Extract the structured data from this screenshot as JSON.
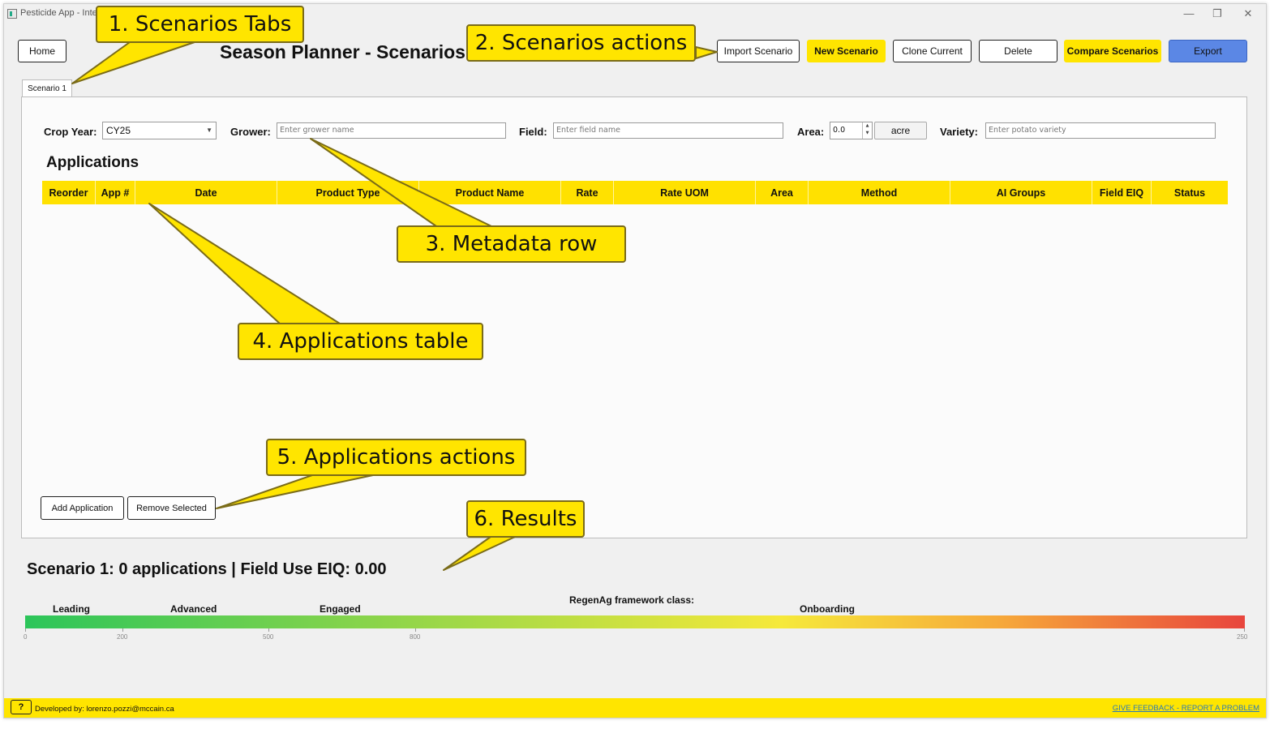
{
  "window": {
    "title": "Pesticide App - Intern"
  },
  "header": {
    "home_label": "Home",
    "title": "Season Planner - Scenarios",
    "actions": {
      "import": "Import Scenario",
      "new": "New Scenario",
      "clone": "Clone Current",
      "delete": "Delete",
      "compare": "Compare Scenarios",
      "export": "Export"
    }
  },
  "tabs": [
    {
      "label": "Scenario 1"
    }
  ],
  "metadata": {
    "crop_year_label": "Crop Year:",
    "crop_year_value": "CY25",
    "grower_label": "Grower:",
    "grower_placeholder": "Enter grower name",
    "field_label": "Field:",
    "field_placeholder": "Enter field name",
    "area_label": "Area:",
    "area_value": "0.0",
    "area_unit": "acre",
    "variety_label": "Variety:",
    "variety_placeholder": "Enter potato variety"
  },
  "applications": {
    "title": "Applications",
    "columns": [
      "Reorder",
      "App #",
      "Date",
      "Product Type",
      "Product Name",
      "Rate",
      "Rate UOM",
      "Area",
      "Method",
      "AI Groups",
      "Field EIQ",
      "Status"
    ],
    "rows": [],
    "add_label": "Add Application",
    "remove_label": "Remove Selected"
  },
  "results": {
    "summary": "Scenario 1: 0 applications | Field Use EIQ: 0.00",
    "framework_label": "RegenAg framework class:",
    "classes": [
      "Leading",
      "Advanced",
      "Engaged",
      "Onboarding"
    ],
    "ticks": [
      "0",
      "200",
      "500",
      "800",
      "250"
    ]
  },
  "footer": {
    "help_label": "?",
    "developer": "Developed by: lorenzo.pozzi@mccain.ca",
    "feedback": "GIVE FEEDBACK - REPORT A PROBLEM"
  },
  "callouts": [
    "1. Scenarios Tabs",
    "2. Scenarios actions",
    "3. Metadata row",
    "4. Applications table",
    "5. Applications actions",
    "6. Results"
  ],
  "colors": {
    "accent_yellow": "#ffe500",
    "export_blue": "#5b87e5",
    "link_blue": "#2a7ab8"
  }
}
